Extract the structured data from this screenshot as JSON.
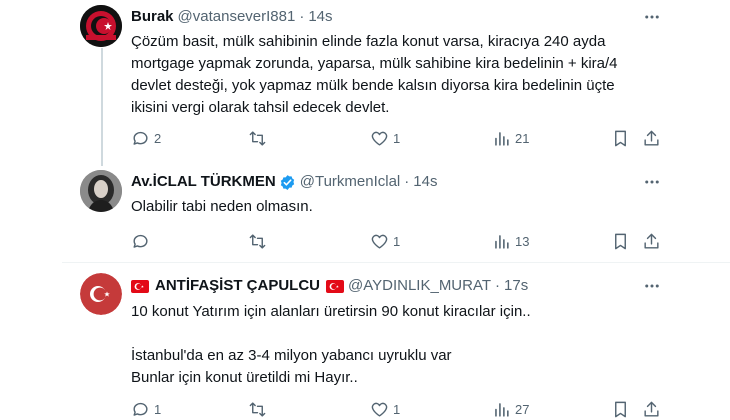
{
  "colors": {
    "text": "#0f1419",
    "muted": "#536471",
    "verified": "#1d9bf0",
    "flag": "#e30a17"
  },
  "tweets": [
    {
      "name": "Burak",
      "handle": "@vatanseverI881",
      "separator": "·",
      "time": "14s",
      "lines": [
        "Çözüm basit, mülk sahibinin elinde fazla konut varsa, kiracıya 240 ayda",
        "mortgage yapmak zorunda, yaparsa, mülk sahibine kira bedelinin + kira/4",
        "devlet desteği, yok yapmaz mülk bende kalsın diyorsa kira bedelinin üçte",
        "ikisini vergi olarak tahsil edecek devlet."
      ],
      "replies": "2",
      "retweets": "",
      "likes": "1",
      "views": "21"
    },
    {
      "name": "Av.İCLAL TÜRKMEN",
      "handle": "@TurkmenIclal",
      "separator": "·",
      "time": "14s",
      "lines": [
        "Olabilir tabi neden olmasın."
      ],
      "replies": "",
      "retweets": "",
      "likes": "1",
      "views": "13"
    },
    {
      "name": "ANTİFAŞİST ÇAPULCU",
      "handle": "@AYDINLIK_MURAT",
      "separator": "·",
      "time": "17s",
      "lines": [
        "10 konut Yatırım için alanları üretirsin 90 konut kiracılar için..",
        "",
        "İstanbul'da en az 3-4 milyon yabancı uyruklu var",
        "Bunlar için konut üretildi mi Hayır.."
      ],
      "replies": "1",
      "retweets": "",
      "likes": "1",
      "views": "27"
    }
  ]
}
